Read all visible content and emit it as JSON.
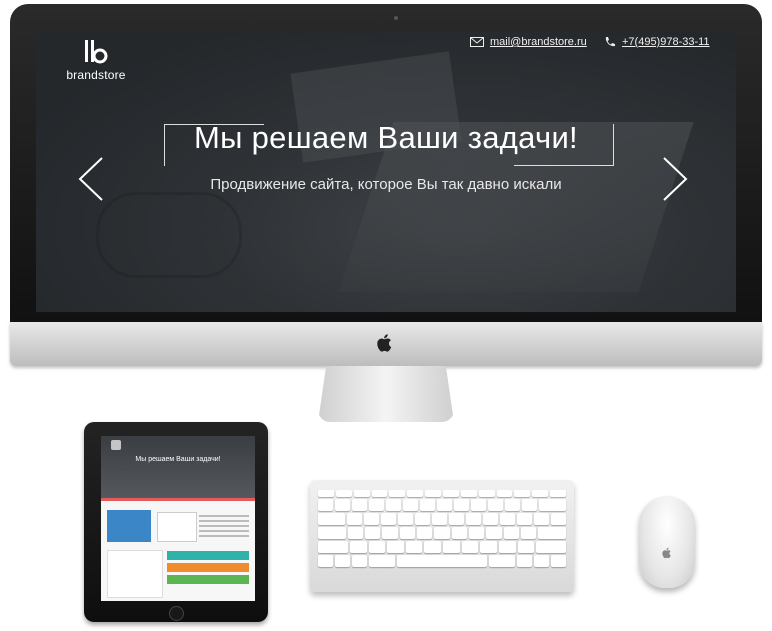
{
  "screen": {
    "logo_text": "brandstore",
    "email": "mail@brandstore.ru",
    "phone": "+7(495)978-33-11",
    "headline": "Мы решаем Ваши задачи!",
    "subheadline": "Продвижение сайта, которое Вы так давно искали"
  },
  "ipad": {
    "headline": "Мы решаем Ваши задачи!"
  },
  "colors": {
    "accent_red": "#e55b5b",
    "teal": "#2fb3a8",
    "orange": "#f08c2e",
    "green": "#5ab552",
    "blue": "#3a86c7"
  }
}
